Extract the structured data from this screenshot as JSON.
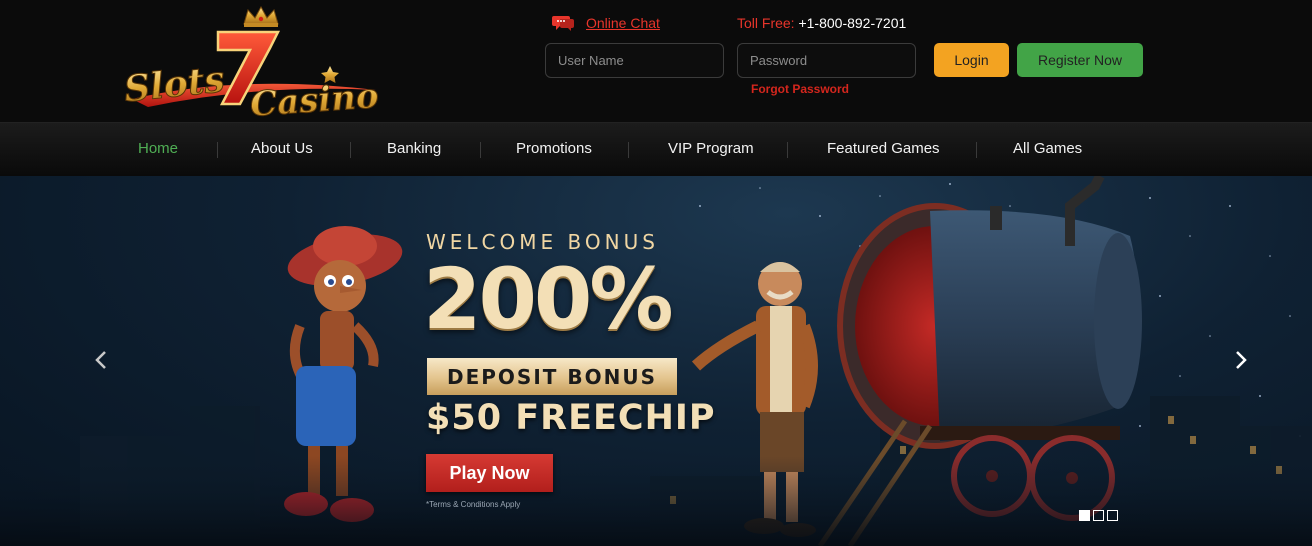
{
  "header": {
    "logo": {
      "text_top": "Slots",
      "numeral": "7",
      "text_bottom": "Casino",
      "icon": "crown-icon"
    },
    "online_chat": {
      "label": "Online Chat",
      "icon": "chat-icon"
    },
    "toll_free": {
      "label": "Toll Free:",
      "number": "+1-800-892-7201"
    },
    "login_form": {
      "username_placeholder": "User Name",
      "password_placeholder": "Password",
      "forgot_password": "Forgot Password",
      "login_label": "Login",
      "register_label": "Register Now"
    }
  },
  "nav": {
    "items": [
      {
        "label": "Home",
        "active": true
      },
      {
        "label": "About Us"
      },
      {
        "label": "Banking"
      },
      {
        "label": "Promotions"
      },
      {
        "label": "VIP Program"
      },
      {
        "label": "Featured Games"
      },
      {
        "label": "All Games"
      }
    ]
  },
  "hero": {
    "headline": "WELCOME BONUS",
    "percentage": "200%",
    "deposit_label": "DEPOSIT BONUS",
    "freechip": "$50 FREECHIP",
    "cta_label": "Play Now",
    "terms": "*Terms & Conditions Apply",
    "slides_total": 3,
    "active_slide": 1,
    "prev_icon": "chevron-left-icon",
    "next_icon": "chevron-right-icon"
  },
  "colors": {
    "accent_red": "#e8352b",
    "login_orange": "#f3a321",
    "register_green": "#42a447",
    "nav_active_green": "#4fae54",
    "gold": "#f3dfb6",
    "background": "#0b0b0b"
  }
}
